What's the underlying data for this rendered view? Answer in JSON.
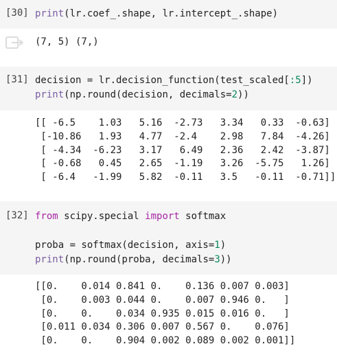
{
  "cells": [
    {
      "prompt": "[30]",
      "code": [
        "print(lr.coef_.shape, lr.intercept_.shape)"
      ],
      "output_icon": "output-collapse-icon",
      "output": [
        "(7, 5) (7,)"
      ]
    },
    {
      "prompt": "[31]",
      "code": [
        "decision = lr.decision_function(test_scaled[:5])",
        "print(np.round(decision, decimals=2))"
      ],
      "output": [
        "[[ -6.5    1.03   5.16  -2.73   3.34   0.33  -0.63]",
        " [-10.86   1.93   4.77  -2.4    2.98   7.84  -4.26]",
        " [ -4.34  -6.23   3.17   6.49   2.36   2.42  -3.87]",
        " [ -0.68   0.45   2.65  -1.19   3.26  -5.75   1.26]",
        " [ -6.4   -1.99   5.82  -0.11   3.5   -0.11  -0.71]]"
      ]
    },
    {
      "prompt": "[32]",
      "code": [
        "from scipy.special import softmax",
        "",
        "proba = softmax(decision, axis=1)",
        "print(np.round(proba, decimals=3))"
      ],
      "output": [
        "[[0.    0.014 0.841 0.    0.136 0.007 0.003]",
        " [0.    0.003 0.044 0.    0.007 0.946 0.   ]",
        " [0.    0.    0.034 0.935 0.015 0.016 0.   ]",
        " [0.011 0.034 0.306 0.007 0.567 0.    0.076]",
        " [0.    0.    0.904 0.002 0.089 0.002 0.001]]"
      ]
    }
  ]
}
